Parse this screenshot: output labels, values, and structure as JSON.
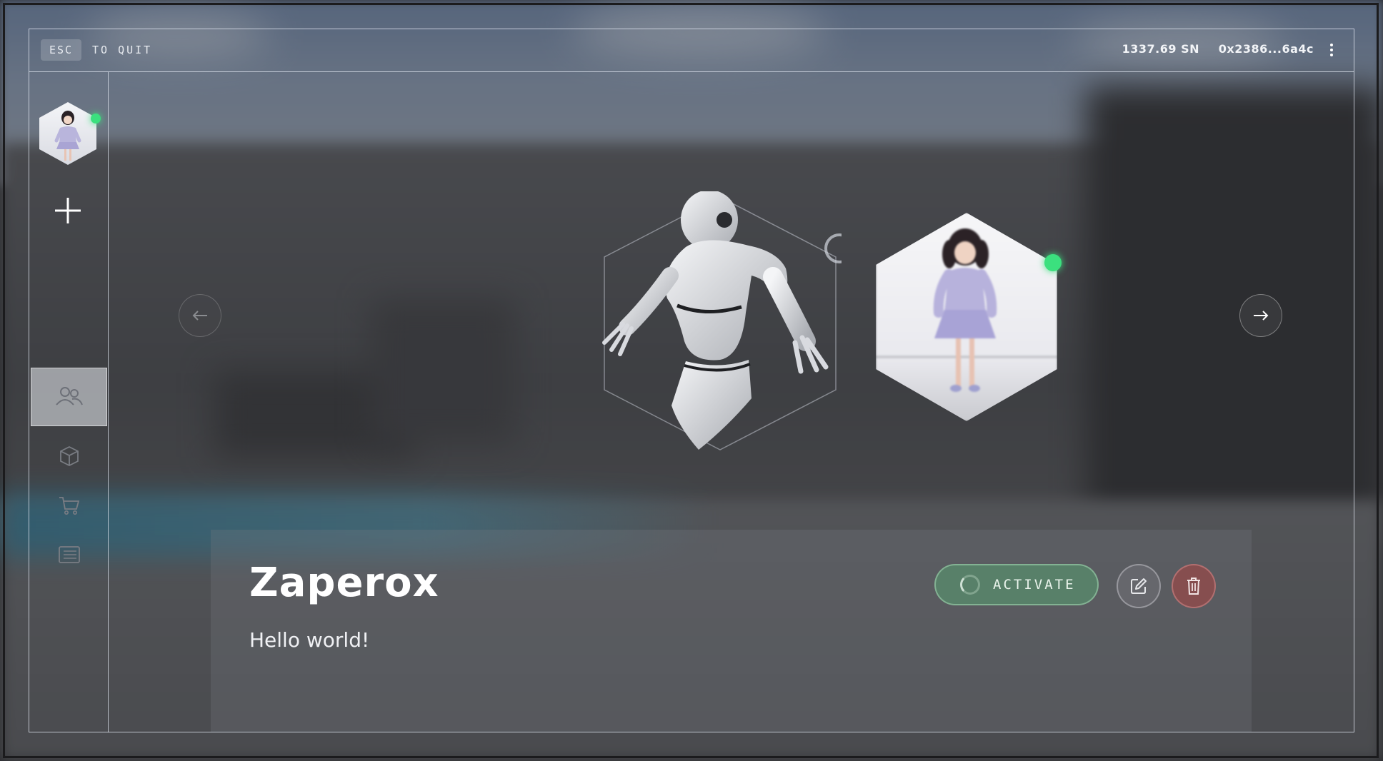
{
  "topbar": {
    "esc_key": "ESC",
    "esc_text": "TO QUIT",
    "balance": "1337.69 SN",
    "wallet": "0x2386...6a4c"
  },
  "sidebar": {
    "avatar_online": true,
    "items": [
      {
        "id": "characters",
        "icon": "users-icon",
        "active": true
      },
      {
        "id": "inventory",
        "icon": "cube-icon",
        "active": false
      },
      {
        "id": "store",
        "icon": "cart-icon",
        "active": false
      },
      {
        "id": "news",
        "icon": "newspaper-icon",
        "active": false
      }
    ]
  },
  "carousel": {
    "selected_character": "robot",
    "next_character_online": true
  },
  "character": {
    "name": "Zaperox",
    "description": "Hello world!",
    "activate_label": "ACTIVATE"
  },
  "colors": {
    "online": "#3be07e",
    "activate": "#588c6c",
    "delete": "#964a4a"
  }
}
